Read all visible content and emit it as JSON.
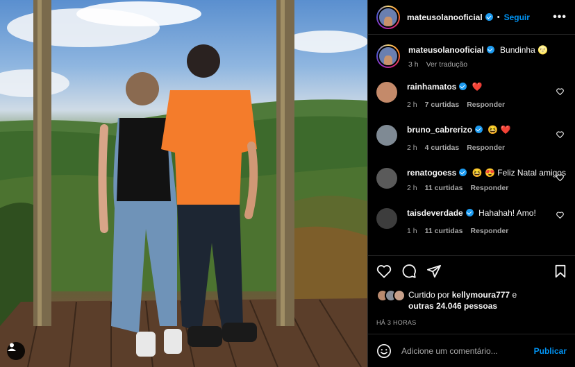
{
  "post": {
    "author": "mateusolanooficial",
    "follow_label": "Seguir",
    "separator": "•",
    "more_label": "•••"
  },
  "caption": {
    "username": "mateusolanooficial",
    "text": "Bundinha",
    "emoji": "🌝",
    "time": "3 h",
    "translate_label": "Ver tradução"
  },
  "comments": [
    {
      "username": "rainhamatos",
      "text": "",
      "emoji": "❤️",
      "time": "2 h",
      "likes": "7 curtidas",
      "reply": "Responder",
      "avatar_color": "#c48a6a"
    },
    {
      "username": "bruno_cabrerizo",
      "text": "",
      "emoji": "😆 ❤️",
      "time": "2 h",
      "likes": "4 curtidas",
      "reply": "Responder",
      "avatar_color": "#7f8a94"
    },
    {
      "username": "renatogoess",
      "text": "😆 😍 Feliz Natal amigos",
      "emoji": "",
      "time": "2 h",
      "likes": "11 curtidas",
      "reply": "Responder",
      "avatar_color": "#5a5a5a"
    },
    {
      "username": "taisdeverdade",
      "text": "Hahahah! Amo!",
      "emoji": "",
      "time": "1 h",
      "likes": "11 curtidas",
      "reply": "Responder",
      "avatar_color": "#3d3d3d"
    }
  ],
  "likes": {
    "prefix": "Curtido por",
    "user": "kellymoura777",
    "suffix": "e",
    "others": "outras 24.046 pessoas"
  },
  "timestamp": "HÁ 3 HORAS",
  "add_comment": {
    "placeholder": "Adicione um comentário...",
    "publish_label": "Publicar"
  },
  "colors": {
    "accent": "#0095f6",
    "verified": "#1d9bf0",
    "heart": "#ff3040"
  }
}
